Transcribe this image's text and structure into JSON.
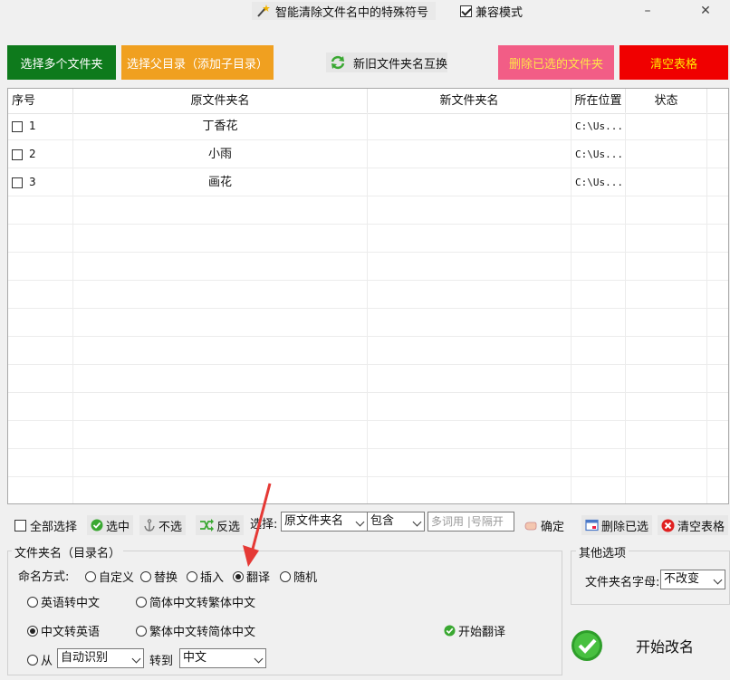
{
  "window": {
    "title": "智能清除文件名中的特殊符号",
    "compat_label": "兼容模式",
    "compat_checked": true,
    "minimize": "–",
    "close": "✕"
  },
  "actions": {
    "select_folders": "选择多个文件夹",
    "select_parent": "选择父目录（添加子目录）",
    "swap_names": "新旧文件夹名互换",
    "delete_selected": "删除已选的文件夹",
    "clear_table": "清空表格"
  },
  "table": {
    "headers": [
      "序号",
      "原文件夹名",
      "新文件夹名",
      "所在位置",
      "状态"
    ],
    "rows": [
      {
        "index": "1",
        "original": "丁香花",
        "new": "",
        "location": "C:\\Us...",
        "status": ""
      },
      {
        "index": "2",
        "original": "小雨",
        "new": "",
        "location": "C:\\Us...",
        "status": ""
      },
      {
        "index": "3",
        "original": "画花",
        "new": "",
        "location": "C:\\Us...",
        "status": ""
      }
    ]
  },
  "selection_toolbar": {
    "select_all": "全部选择",
    "check": "选中",
    "uncheck": "不选",
    "invert": "反选",
    "select_label": "选择:",
    "field_value": "原文件夹名",
    "match_value": "包含",
    "keyword_placeholder": "多词用 |号隔开",
    "confirm": "确定",
    "delete_checked": "删除已选",
    "clear_table": "清空表格"
  },
  "folder_group": {
    "title": "文件夹名（目录名）",
    "mode_label": "命名方式:",
    "modes": [
      "自定义",
      "替换",
      "插入",
      "翻译",
      "随机"
    ],
    "selected_mode": "翻译",
    "translate_options": {
      "en_to_zh": "英语转中文",
      "simp_to_trad": "简体中文转繁体中文",
      "zh_to_en": "中文转英语",
      "trad_to_simp": "繁体中文转简体中文",
      "from_label": "从",
      "from_value": "自动识别",
      "to_label": "转到",
      "to_value": "中文",
      "selected": "中文转英语"
    },
    "start_translate": "开始翻译"
  },
  "other_group": {
    "title": "其他选项",
    "letter_label": "文件夹名字母:",
    "letter_value": "不改变"
  },
  "start_rename": "开始改名",
  "colors": {
    "green": "#0e7a1c",
    "orange": "#f0a020",
    "pink": "#f25d86",
    "red": "#f00000",
    "yellow_text": "#ffea00"
  }
}
